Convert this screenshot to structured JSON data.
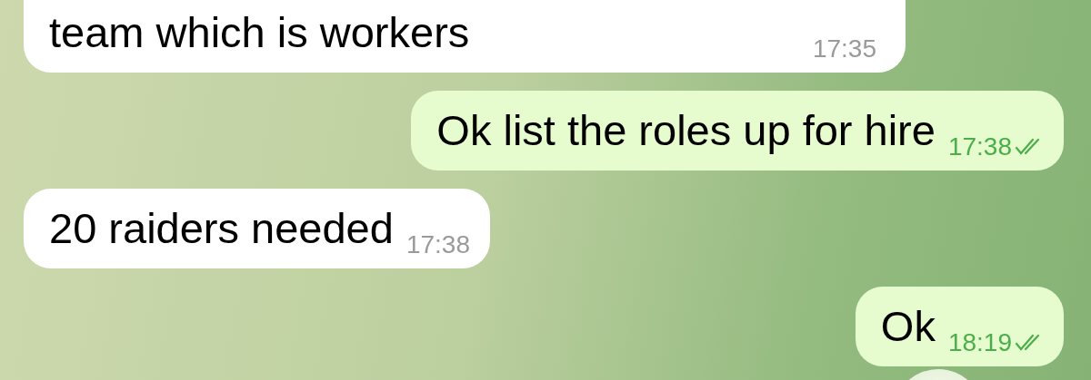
{
  "messages": [
    {
      "kind": "incoming",
      "text": "team which is workers",
      "time": "17:35"
    },
    {
      "kind": "outgoing",
      "text": "Ok list the roles up for hire",
      "time": "17:38",
      "read": true
    },
    {
      "kind": "incoming",
      "text": "20 raiders needed",
      "time": "17:38"
    },
    {
      "kind": "outgoing",
      "text": "Ok",
      "time": "18:19",
      "read": true
    }
  ]
}
